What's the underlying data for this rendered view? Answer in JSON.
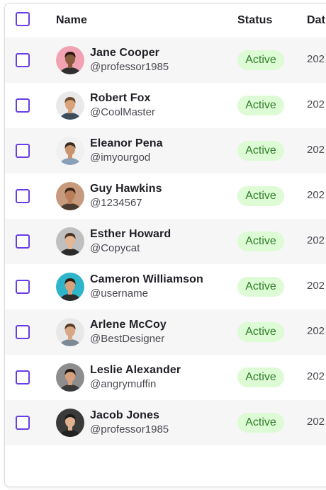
{
  "table": {
    "columns": {
      "name": "Name",
      "status": "Status",
      "date": "Dat"
    },
    "rows": [
      {
        "name": "Jane Cooper",
        "handle": "@professor1985",
        "status": "Active",
        "date": "202",
        "avatar_bg": "#f2a3b3",
        "avatar_skin": "#8a5a3c",
        "avatar_hair": "#2b1a12",
        "avatar_shirt": "#2e2e2e"
      },
      {
        "name": "Robert Fox",
        "handle": "@CoolMaster",
        "status": "Active",
        "date": "202",
        "avatar_bg": "#e9e9ea",
        "avatar_skin": "#d9a27a",
        "avatar_hair": "#6b4a2c",
        "avatar_shirt": "#3d4d5c"
      },
      {
        "name": "Eleanor Pena",
        "handle": "@imyourgod",
        "status": "Active",
        "date": "202",
        "avatar_bg": "#f0f0f0",
        "avatar_skin": "#c9946d",
        "avatar_hair": "#3a2a20",
        "avatar_shirt": "#8aa0b8"
      },
      {
        "name": "Guy Hawkins",
        "handle": "@1234567",
        "status": "Active",
        "date": "202",
        "avatar_bg": "#c79a7e",
        "avatar_skin": "#b97f5a",
        "avatar_hair": "#3b2618",
        "avatar_shirt": "#4a3a30"
      },
      {
        "name": "Esther Howard",
        "handle": "@Copycat",
        "status": "Active",
        "date": "202",
        "avatar_bg": "#bfbfbf",
        "avatar_skin": "#e3b695",
        "avatar_hair": "#4a3322",
        "avatar_shirt": "#2b2b2b"
      },
      {
        "name": "Cameron Williamson",
        "handle": "@username",
        "status": "Active",
        "date": "202",
        "avatar_bg": "#2fb4c9",
        "avatar_skin": "#d9a27a",
        "avatar_hair": "#2b1a12",
        "avatar_shirt": "#2c2c2c"
      },
      {
        "name": "Arlene McCoy",
        "handle": "@BestDesigner",
        "status": "Active",
        "date": "202",
        "avatar_bg": "#e8e8e8",
        "avatar_skin": "#d8a784",
        "avatar_hair": "#5a3d28",
        "avatar_shirt": "#7c8a96"
      },
      {
        "name": "Leslie Alexander",
        "handle": "@angrymuffin",
        "status": "Active",
        "date": "202",
        "avatar_bg": "#8d8d8d",
        "avatar_skin": "#d6a07c",
        "avatar_hair": "#1f1712",
        "avatar_shirt": "#3a3a3a"
      },
      {
        "name": "Jacob Jones",
        "handle": "@professor1985",
        "status": "Active",
        "date": "202",
        "avatar_bg": "#3a3a3a",
        "avatar_skin": "#e0b090",
        "avatar_hair": "#1a1a1a",
        "avatar_shirt": "#222222"
      }
    ]
  },
  "colors": {
    "checkbox_border": "#6a3de8",
    "badge_bg": "#ddfbd5",
    "badge_text": "#2f7d2a",
    "row_alt_bg": "#f6f6f7"
  }
}
